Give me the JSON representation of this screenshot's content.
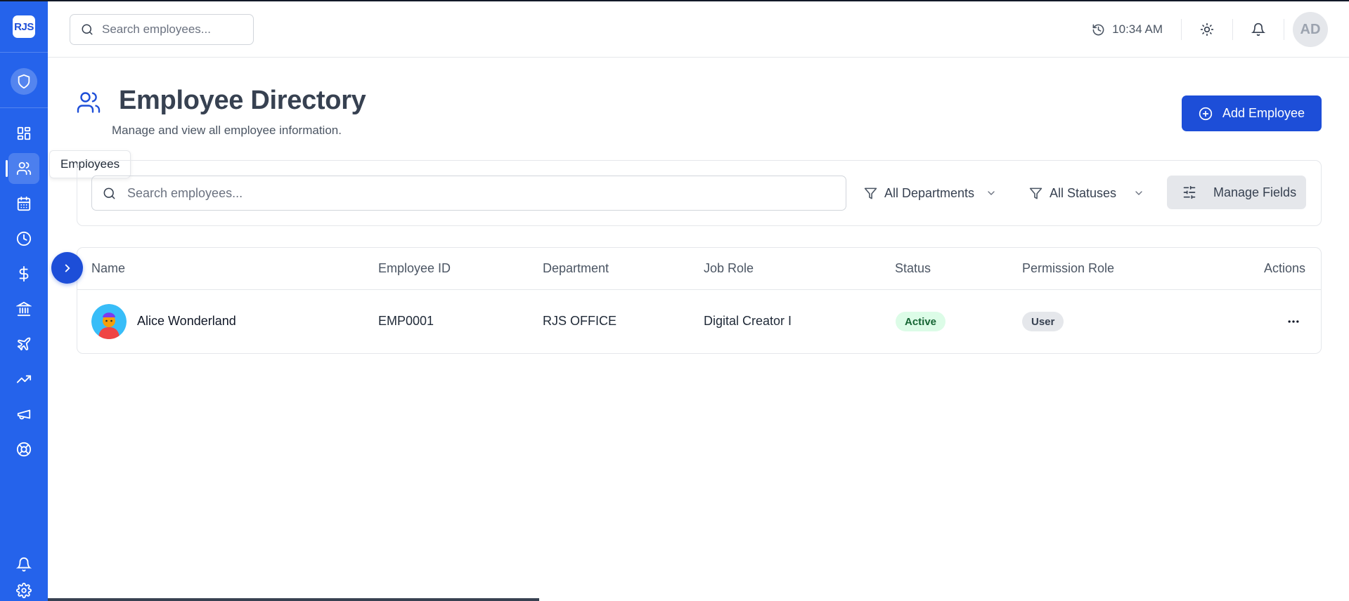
{
  "app": {
    "logo_text": "RJS",
    "tooltip": "Employees",
    "accent_color": "#2563eb",
    "button_color": "#1d4ed8"
  },
  "sidebar": {
    "items": [
      {
        "icon": "dashboard-icon"
      },
      {
        "icon": "users-icon",
        "active": true
      },
      {
        "icon": "calendar-icon"
      },
      {
        "icon": "clock-icon"
      },
      {
        "icon": "dollar-icon"
      },
      {
        "icon": "bank-icon"
      },
      {
        "icon": "plane-icon"
      },
      {
        "icon": "trending-up-icon"
      },
      {
        "icon": "megaphone-icon"
      },
      {
        "icon": "lifebuoy-icon"
      }
    ],
    "bottom_items": [
      {
        "icon": "bell-icon"
      },
      {
        "icon": "gear-icon"
      }
    ]
  },
  "topbar": {
    "search_placeholder": "Search employees...",
    "time": "10:34 AM",
    "avatar_initials": "AD"
  },
  "header": {
    "title": "Employee Directory",
    "subtitle": "Manage and view all employee information.",
    "add_button_label": "Add Employee"
  },
  "filters": {
    "search_placeholder": "Search employees...",
    "department": "All Departments",
    "status": "All Statuses",
    "manage_fields_label": "Manage Fields"
  },
  "table": {
    "columns": [
      "Name",
      "Employee ID",
      "Department",
      "Job Role",
      "Status",
      "Permission Role",
      "Actions"
    ],
    "rows": [
      {
        "name": "Alice Wonderland",
        "employee_id": "EMP0001",
        "department": "RJS OFFICE",
        "job_role": "Digital Creator I",
        "status": "Active",
        "permission_role": "User"
      }
    ]
  }
}
